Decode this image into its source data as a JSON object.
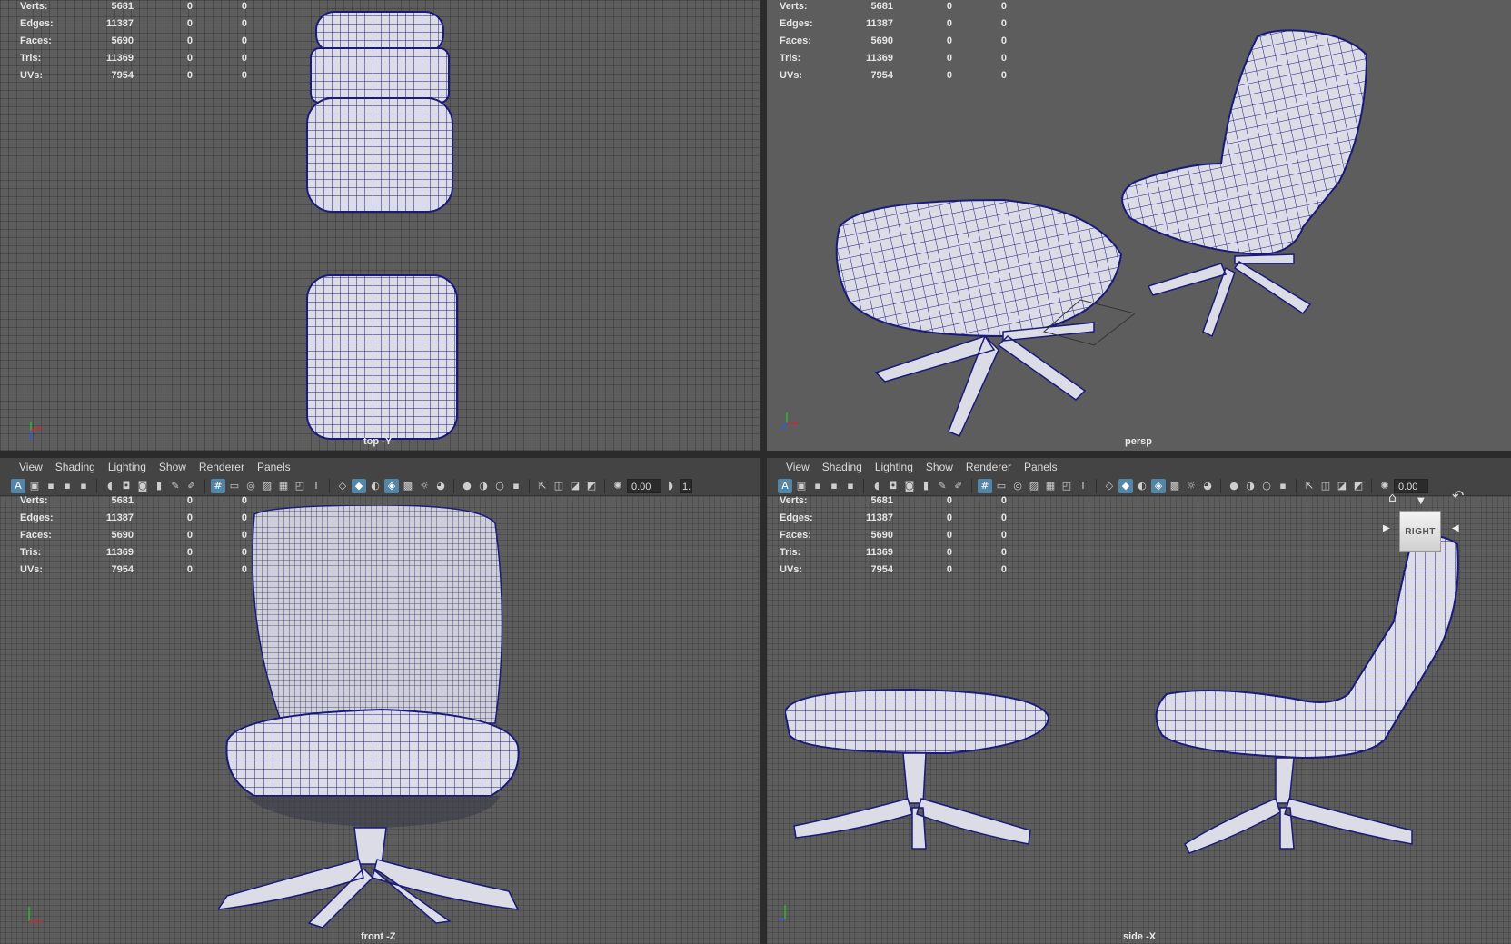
{
  "hud_stats": [
    {
      "label": "Verts:",
      "value": "5681",
      "sel": "0",
      "comp": "0"
    },
    {
      "label": "Edges:",
      "value": "11387",
      "sel": "0",
      "comp": "0"
    },
    {
      "label": "Faces:",
      "value": "5690",
      "sel": "0",
      "comp": "0"
    },
    {
      "label": "Tris:",
      "value": "11369",
      "sel": "0",
      "comp": "0"
    },
    {
      "label": "UVs:",
      "value": "7954",
      "sel": "0",
      "comp": "0"
    }
  ],
  "panel_menu": [
    "View",
    "Shading",
    "Lighting",
    "Show",
    "Renderer",
    "Panels"
  ],
  "toolbar": {
    "exposure_value": "0.00",
    "gamma_value_partial": "1."
  },
  "viewports": {
    "top": {
      "camera": "top -Y"
    },
    "persp": {
      "camera": "persp"
    },
    "front": {
      "camera": "front -Z"
    },
    "side": {
      "camera": "side -X"
    }
  },
  "viewcube": {
    "face_label": "RIGHT"
  },
  "colors": {
    "viewport_bg": "#5d5d5d",
    "wire": "#1a1a7a",
    "mesh_fill": "#d9d9e4",
    "panel_bar": "#444444",
    "active_icon": "#5285a6"
  }
}
